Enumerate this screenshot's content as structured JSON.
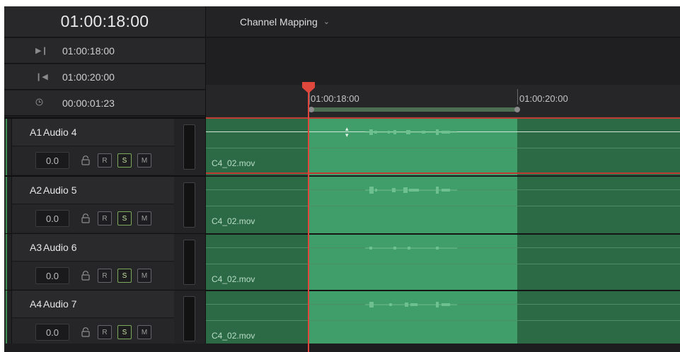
{
  "timecode": {
    "current": "01:00:18:00",
    "in": "01:00:18:00",
    "out": "01:00:20:00",
    "duration": "00:00:01:23"
  },
  "header": {
    "menu_label": "Channel Mapping",
    "menu_icon": "chevron-down-icon"
  },
  "ruler": {
    "ticks": [
      "01:00:18:00",
      "01:00:20:00"
    ]
  },
  "tracks": [
    {
      "id": "A1",
      "name": "Audio 4",
      "volume": "0.0",
      "record": "R",
      "solo": "S",
      "mute": "M",
      "clip": "C4_02.mov"
    },
    {
      "id": "A2",
      "name": "Audio 5",
      "volume": "0.0",
      "record": "R",
      "solo": "S",
      "mute": "M",
      "clip": "C4_02.mov"
    },
    {
      "id": "A3",
      "name": "Audio 6",
      "volume": "0.0",
      "record": "R",
      "solo": "S",
      "mute": "M",
      "clip": "C4_02.mov"
    },
    {
      "id": "A4",
      "name": "Audio 7",
      "volume": "0.0",
      "record": "R",
      "solo": "S",
      "mute": "M",
      "clip": "C4_02.mov"
    }
  ],
  "colors": {
    "playhead": "#e0473c",
    "clip": "#2c6a45",
    "clip_selected": "#3f9e69",
    "solo_active": "#7aaa5a"
  }
}
